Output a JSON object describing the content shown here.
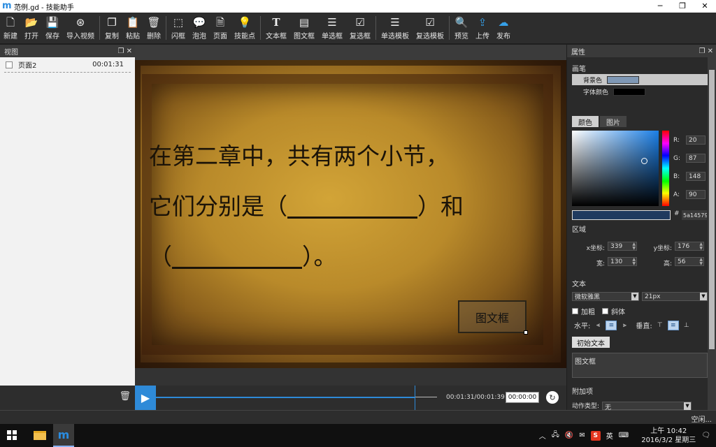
{
  "window": {
    "title": "范例.gd - 技能助手",
    "minimize": "─",
    "maximize": "❐",
    "close": "✕"
  },
  "toolbar": {
    "groups": [
      [
        {
          "label": "新建",
          "icon": "new-file-icon"
        },
        {
          "label": "打开",
          "icon": "folder-open-icon"
        },
        {
          "label": "保存",
          "icon": "save-icon"
        },
        {
          "label": "导入视频",
          "icon": "film-reel-icon"
        }
      ],
      [
        {
          "label": "复制",
          "icon": "copy-icon"
        },
        {
          "label": "粘贴",
          "icon": "paste-icon"
        },
        {
          "label": "删除",
          "icon": "trash-icon"
        }
      ],
      [
        {
          "label": "闪框",
          "icon": "dashed-rect-icon"
        },
        {
          "label": "泡泡",
          "icon": "speech-bubble-icon"
        },
        {
          "label": "页面",
          "icon": "page-icon"
        },
        {
          "label": "技能点",
          "icon": "lightbulb-icon"
        }
      ],
      [
        {
          "label": "文本框",
          "icon": "text-t-icon"
        },
        {
          "label": "图文框",
          "icon": "image-text-icon"
        },
        {
          "label": "单选框",
          "icon": "radio-list-icon"
        },
        {
          "label": "复选框",
          "icon": "checkbox-list-icon"
        }
      ],
      [
        {
          "label": "单选模板",
          "icon": "radio-template-icon"
        },
        {
          "label": "复选模板",
          "icon": "checkbox-template-icon"
        }
      ],
      [
        {
          "label": "预览",
          "icon": "search-icon"
        },
        {
          "label": "上传",
          "icon": "upload-icon"
        },
        {
          "label": "发布",
          "icon": "cloud-publish-icon"
        }
      ]
    ]
  },
  "left_panel": {
    "title": "视图",
    "pages": [
      {
        "name": "页面2",
        "time": "00:01:31"
      }
    ]
  },
  "stage": {
    "line1": "在第二章中，共有两个小节，",
    "line2_start": "它们分别是（",
    "line2_end": "）和",
    "line3_start": "（",
    "line3_end": "）。",
    "box_label": "图文框"
  },
  "timeline": {
    "time_text": "00:01:31/00:01:39",
    "time_input": "00:00:00",
    "progress": 0.92
  },
  "properties": {
    "title": "属性",
    "brush_title": "画笔",
    "bg_color_label": "背景色",
    "bg_color": "#7f98b5",
    "font_color_label": "字体颜色",
    "font_color": "#000000",
    "tabs": [
      "颜色",
      "图片"
    ],
    "rgba": [
      {
        "label": "R:",
        "value": "20"
      },
      {
        "label": "G:",
        "value": "87"
      },
      {
        "label": "B:",
        "value": "148"
      },
      {
        "label": "A:",
        "value": "90"
      }
    ],
    "hex_label": "#",
    "hex_value": "5a14579",
    "region_title": "区域",
    "coords": [
      {
        "label": "x坐标:",
        "value": "339"
      },
      {
        "label": "y坐标:",
        "value": "176"
      },
      {
        "label": "宽:",
        "value": "130"
      },
      {
        "label": "高:",
        "value": "56"
      }
    ],
    "text_title": "文本",
    "font_family": "微软雅黑",
    "font_size": "21px",
    "bold_label": "加粗",
    "italic_label": "斜体",
    "horizontal_label": "水平:",
    "vertical_label": "垂直:",
    "initial_text_button": "初始文本",
    "initial_text_value": "图文框",
    "addon_title": "附加项",
    "anim_type_label": "动作类型:",
    "anim_type_value": "无"
  },
  "status": {
    "text": "空闲..."
  },
  "taskbar": {
    "ime": "英",
    "time": "上午 10:42",
    "date": "2016/3/2 星期三"
  },
  "colors": {
    "accent": "#2e8ad8",
    "toolbar_bg": "#2d2d2d",
    "panel_bg": "#2a2a2a"
  }
}
